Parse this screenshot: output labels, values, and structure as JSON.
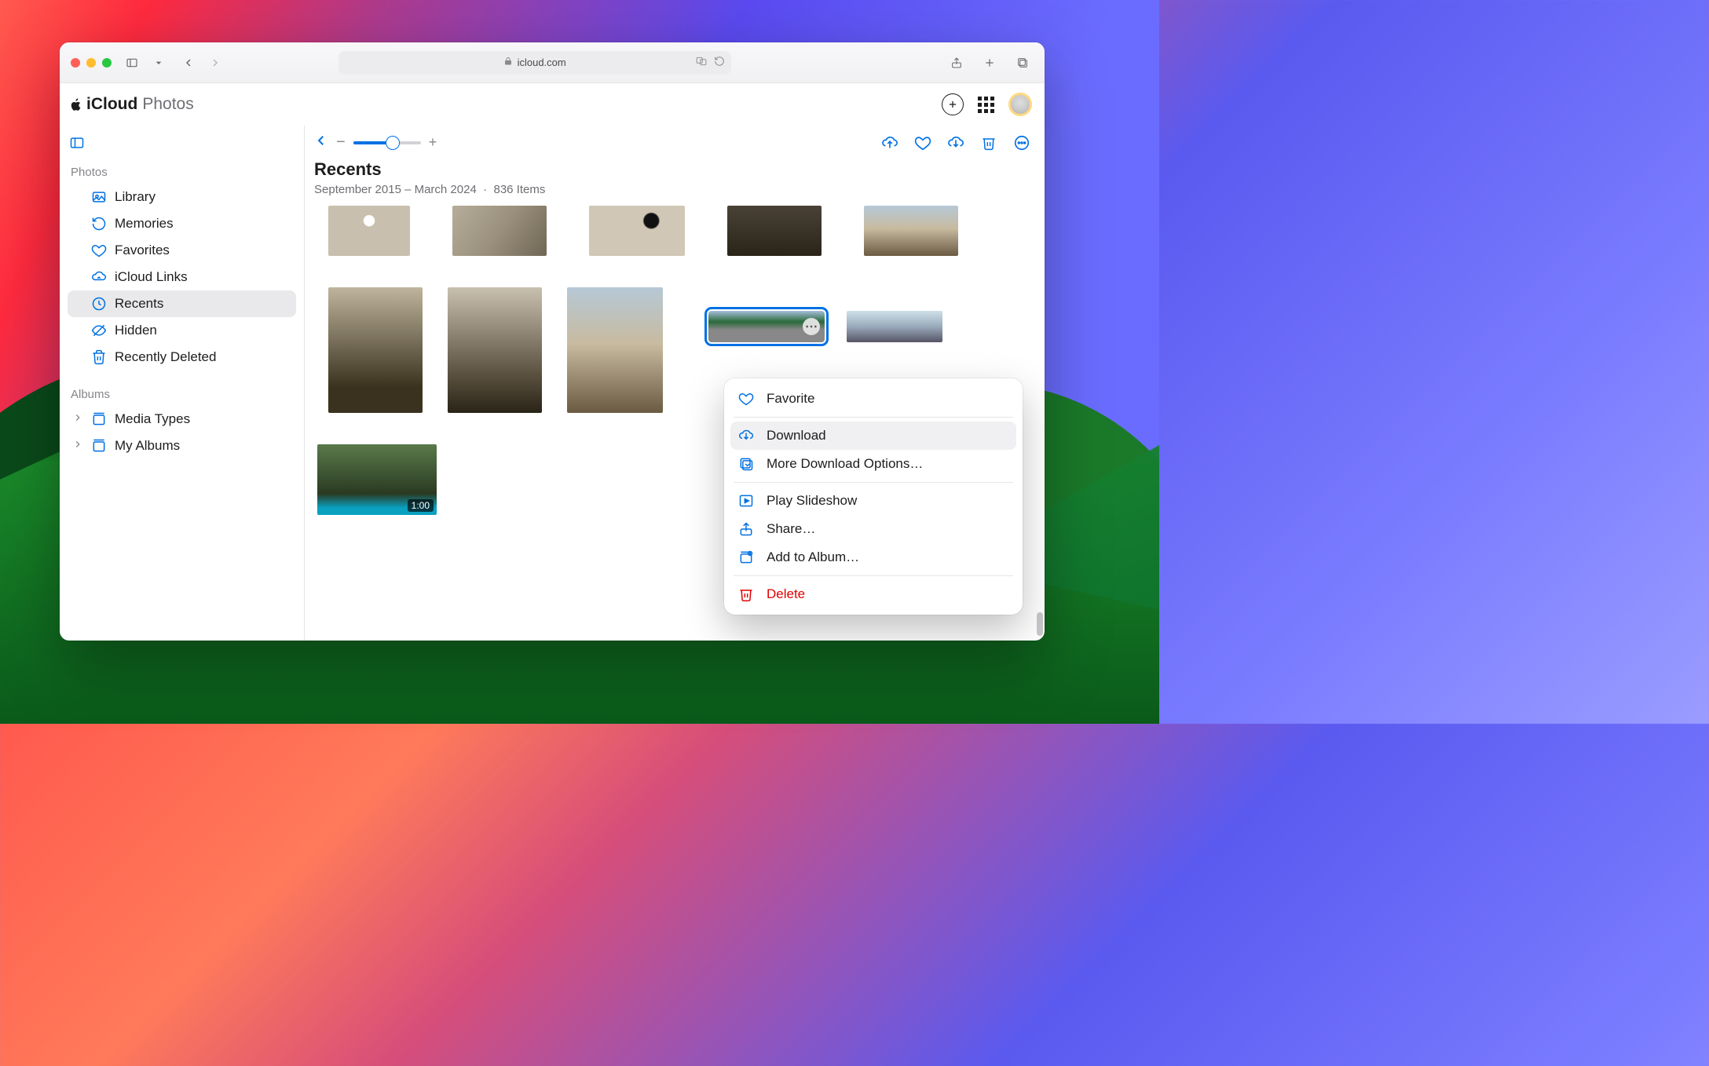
{
  "browser": {
    "url_host": "icloud.com"
  },
  "app": {
    "brand": "iCloud",
    "section": "Photos"
  },
  "sidebar": {
    "sections": {
      "photos_label": "Photos",
      "albums_label": "Albums"
    },
    "items": {
      "library": "Library",
      "memories": "Memories",
      "favorites": "Favorites",
      "icloud_links": "iCloud Links",
      "recents": "Recents",
      "hidden": "Hidden",
      "recently_deleted": "Recently Deleted",
      "media_types": "Media Types",
      "my_albums": "My Albums"
    }
  },
  "main": {
    "title": "Recents",
    "date_range": "September 2015 – March 2024",
    "dot": "·",
    "count_label": "836 Items",
    "video_duration": "1:00"
  },
  "context_menu": {
    "favorite": "Favorite",
    "download": "Download",
    "more_download": "More Download Options…",
    "slideshow": "Play Slideshow",
    "share": "Share…",
    "add_album": "Add to Album…",
    "delete": "Delete"
  }
}
